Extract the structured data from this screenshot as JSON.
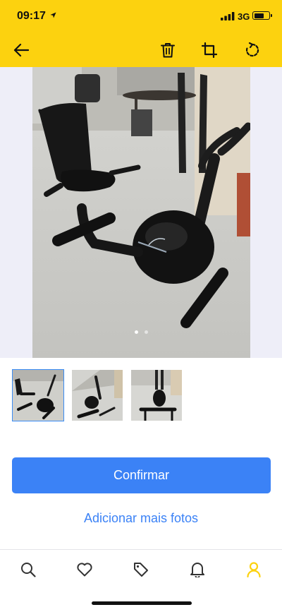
{
  "status_bar": {
    "time": "09:17",
    "network": "3G",
    "battery_level": 0.7
  },
  "toolbar": {
    "back_icon": "arrow-left-icon",
    "delete_icon": "trash-icon",
    "crop_icon": "crop-icon",
    "rotate_icon": "rotate-icon"
  },
  "colors": {
    "header": "#fcd20f",
    "primary": "#3b82f6",
    "photo_bg": "#eeeef8",
    "tab_active": "#fcd20f"
  },
  "gallery": {
    "photo_count": 3,
    "current_index": 0
  },
  "thumbnails": [
    {
      "selected": true
    },
    {
      "selected": false
    },
    {
      "selected": false
    }
  ],
  "actions": {
    "confirm_label": "Confirmar",
    "add_more_label": "Adicionar mais fotos"
  },
  "tab_bar": {
    "items": [
      {
        "icon": "search-icon",
        "active": false
      },
      {
        "icon": "heart-icon",
        "active": false
      },
      {
        "icon": "tag-icon",
        "active": false
      },
      {
        "icon": "bell-icon",
        "active": false
      },
      {
        "icon": "user-icon",
        "active": true
      }
    ]
  }
}
